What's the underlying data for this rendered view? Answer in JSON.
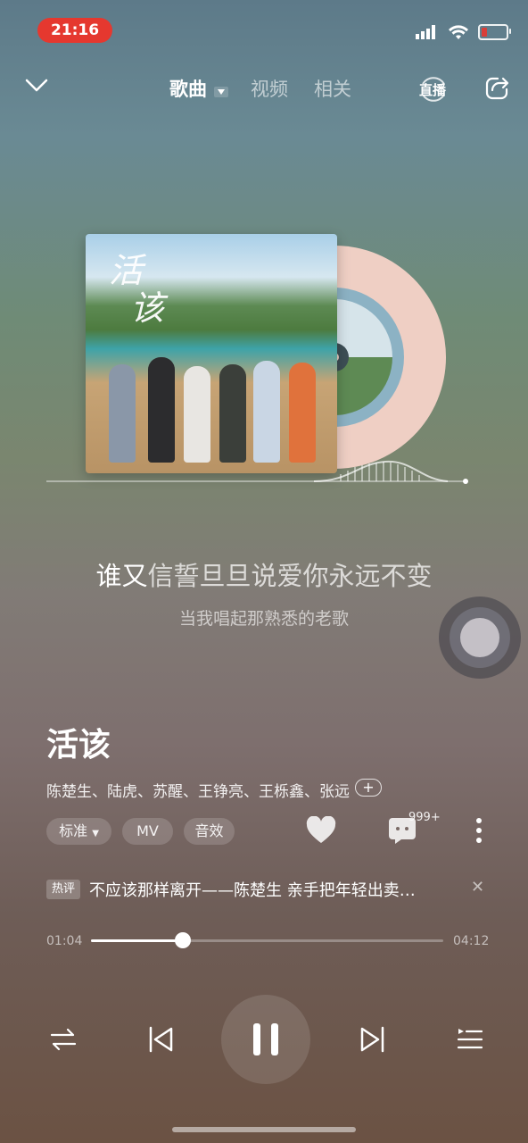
{
  "status_bar": {
    "time": "21:16"
  },
  "nav": {
    "tabs": [
      {
        "label": "歌曲",
        "active": true
      },
      {
        "label": "视频",
        "active": false
      },
      {
        "label": "相关",
        "active": false
      }
    ],
    "live_label": "直播"
  },
  "album": {
    "cover_title_line1": "活",
    "cover_title_line2": "该"
  },
  "lyrics": {
    "current_sung": "谁又",
    "current_rest": "信誓旦旦说爱你永远不变",
    "next": "当我唱起那熟悉的老歌"
  },
  "song": {
    "title": "活该",
    "artists": "陈楚生、陆虎、苏醒、王铮亮、王栎鑫、张远",
    "add_artist": "+"
  },
  "actions": {
    "quality_label": "标准",
    "mv_label": "MV",
    "effect_label": "音效",
    "comment_count": "999+"
  },
  "hot_comment": {
    "badge": "热评",
    "text": "不应该那样离开——陈楚生 亲手把年轻出卖…",
    "close": "✕"
  },
  "progress": {
    "current": "01:04",
    "total": "04:12",
    "fraction": 0.26
  },
  "colors": {
    "accent_red": "#e5382f"
  }
}
